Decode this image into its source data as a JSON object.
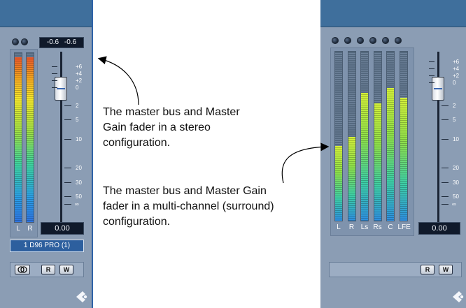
{
  "stereo_mixer": {
    "readout_left": "-0.6",
    "readout_right": "-0.6",
    "channel_labels": [
      "L",
      "R"
    ],
    "gain_value": "0.00",
    "bus_name": "1 D96 PRO (1)",
    "read_button": "R",
    "write_button": "W"
  },
  "surround_mixer": {
    "channel_labels": [
      "L",
      "R",
      "Ls",
      "Rs",
      "C",
      "LFE"
    ],
    "levels": [
      0.44,
      0.49,
      0.75,
      0.69,
      0.78,
      0.72
    ],
    "gain_value": "0.00",
    "read_button": "R",
    "write_button": "W"
  },
  "fader_scale": [
    "+6",
    "+4",
    "+2",
    "0",
    "2",
    "5",
    "10",
    "20",
    "30",
    "50",
    "∞"
  ],
  "captions": {
    "stereo": "The master bus and Master Gain fader in a stereo configuration.",
    "surround": "The master bus and Master Gain fader in a multi-channel (surround) configuration."
  },
  "colors": {
    "panel": "#8b9db4",
    "header": "#3f6f9c",
    "meter_low": "#2e8fe0",
    "meter_mid": "#8fe04a",
    "meter_high": "#f0a020"
  }
}
